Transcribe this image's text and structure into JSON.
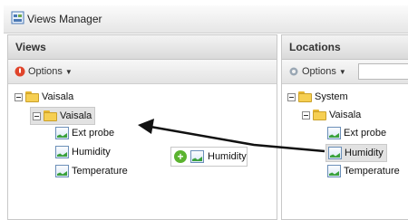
{
  "window": {
    "title": "Views Manager"
  },
  "views_panel": {
    "header": "Views",
    "options_label": "Options",
    "tree": [
      {
        "label": "Vaisala",
        "type": "folder"
      },
      {
        "label": "Vaisala",
        "type": "folder",
        "selected": true
      },
      {
        "label": "Ext probe",
        "type": "sensor"
      },
      {
        "label": "Humidity",
        "type": "sensor"
      },
      {
        "label": "Temperature",
        "type": "sensor"
      }
    ],
    "drag_item": {
      "label": "Humidity"
    }
  },
  "locations_panel": {
    "header": "Locations",
    "options_label": "Options",
    "tree": [
      {
        "label": "System",
        "type": "folder"
      },
      {
        "label": "Vaisala",
        "type": "folder"
      },
      {
        "label": "Ext probe",
        "type": "sensor"
      },
      {
        "label": "Humidity",
        "type": "sensor",
        "selected": true
      },
      {
        "label": "Temperature",
        "type": "sensor"
      }
    ]
  },
  "colors": {
    "folder": "#f6cf52",
    "add_badge": "#5bb32f",
    "options_icon": "#e0452c",
    "selection_bg": "#e2e2e2"
  }
}
